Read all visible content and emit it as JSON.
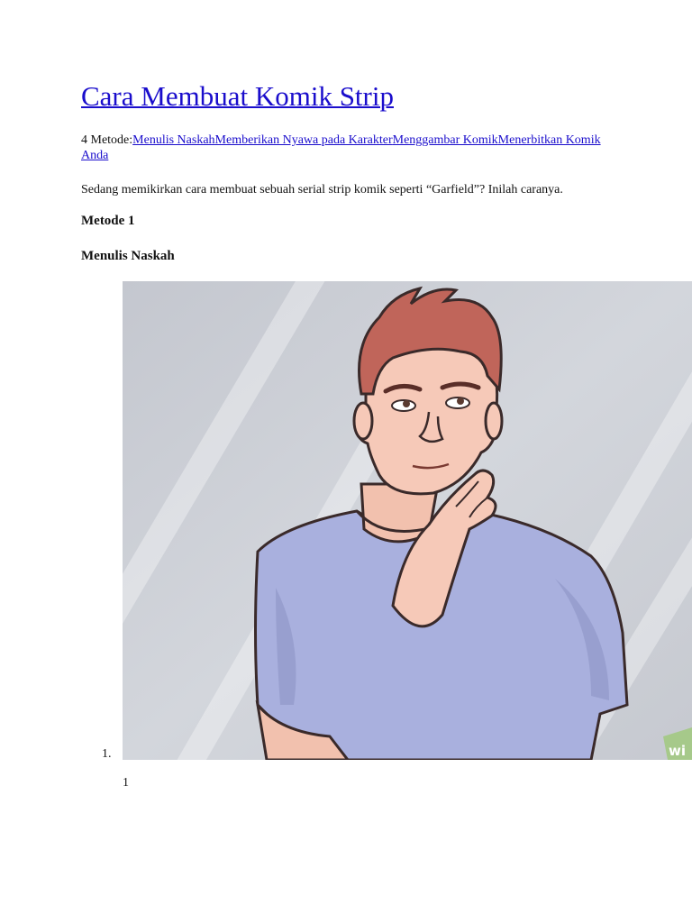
{
  "article": {
    "title": "Cara Membuat Komik Strip",
    "methods_prefix": "4 Metode:",
    "methods": [
      "Menulis Naskah",
      "Memberikan Nyawa pada Karakter",
      "Menggambar Komik",
      "Menerbitkan Komik Anda"
    ],
    "intro": "Sedang memikirkan cara membuat sebuah serial strip komik seperti “Garfield”? Inilah caranya.",
    "method_label": "Metode 1",
    "section_title": "Menulis Naskah",
    "steps": [
      {
        "number": "1.",
        "sub_number": "1"
      }
    ],
    "watermark": "wi"
  },
  "colors": {
    "link": "#1a0dcc",
    "background": "#ffffff",
    "illustration_bg": "#c9ccd3",
    "hair": "#c0655a",
    "skin": "#f6c9b8",
    "shirt": "#a9b0de"
  }
}
